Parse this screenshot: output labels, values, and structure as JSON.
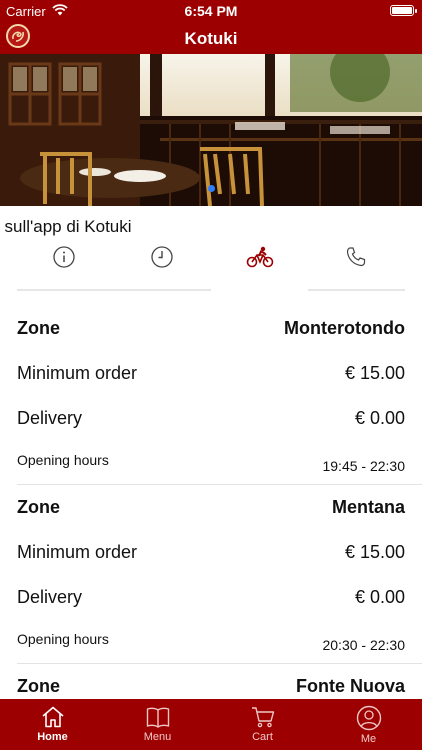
{
  "status_bar": {
    "carrier": "Carrier",
    "time": "6:54 PM"
  },
  "nav": {
    "title": "Kotuki"
  },
  "marquee": {
    "text": "i sull'app di Kotuki"
  },
  "info_tabs": [
    {
      "icon": "info-icon"
    },
    {
      "icon": "clock-icon"
    },
    {
      "icon": "bicycle-icon",
      "active": true
    },
    {
      "icon": "phone-icon"
    }
  ],
  "zones": [
    {
      "zone_label": "Zone",
      "zone_name": "Monterotondo",
      "min_label": "Minimum order",
      "min_value": "€ 15.00",
      "delivery_label": "Delivery",
      "delivery_value": "€ 0.00",
      "hours_label": "Opening hours",
      "hours_value": "19:45 - 22:30"
    },
    {
      "zone_label": "Zone",
      "zone_name": "Mentana",
      "min_label": "Minimum order",
      "min_value": "€ 15.00",
      "delivery_label": "Delivery",
      "delivery_value": "€ 0.00",
      "hours_label": "Opening hours",
      "hours_value": "20:30 - 22:30"
    },
    {
      "zone_label": "Zone",
      "zone_name": "Fonte Nuova"
    }
  ],
  "tab_bar": [
    {
      "label": "Home",
      "icon": "home-icon",
      "active": true
    },
    {
      "label": "Menu",
      "icon": "menu-book-icon"
    },
    {
      "label": "Cart",
      "icon": "cart-icon"
    },
    {
      "label": "Me",
      "icon": "user-icon"
    }
  ],
  "colors": {
    "brand": "#9c0000",
    "active_icon": "#9c0000"
  }
}
